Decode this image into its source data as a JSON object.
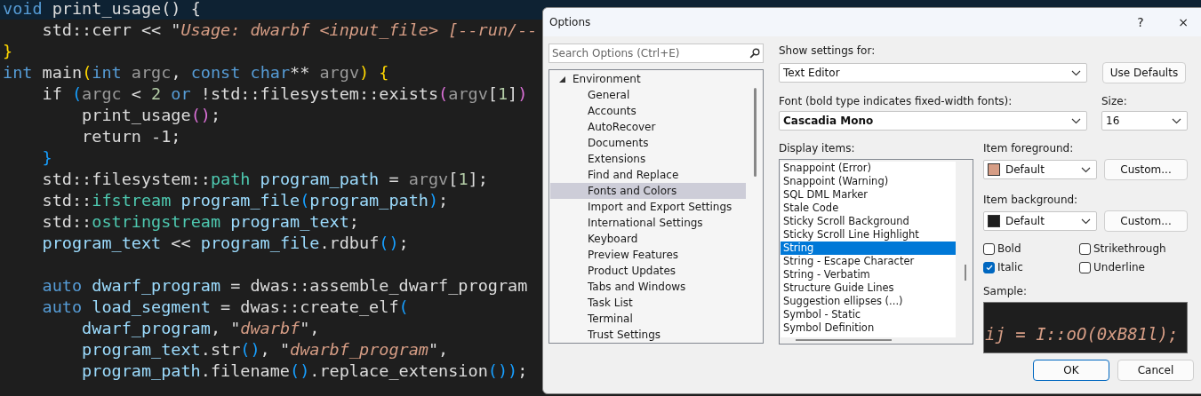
{
  "editor": {
    "lines": [
      {
        "current": true,
        "tokens": [
          {
            "kind": "kw",
            "text": "void"
          },
          {
            "kind": "plain",
            "text": " print_usage() {"
          }
        ]
      },
      {
        "current": false,
        "tokens": [
          {
            "kind": "plain",
            "text": "    std::cerr << \""
          },
          {
            "kind": "str",
            "text": "Usage: dwarbf <input_file> [--run/--"
          }
        ]
      },
      {
        "current": false,
        "tokens": [
          {
            "kind": "b1",
            "text": "}"
          }
        ]
      },
      {
        "current": false,
        "tokens": [
          {
            "kind": "kw",
            "text": "int"
          },
          {
            "kind": "plain",
            "text": " main"
          },
          {
            "kind": "b1",
            "text": "("
          },
          {
            "kind": "kw",
            "text": "int"
          },
          {
            "kind": "param",
            "text": " argc"
          },
          {
            "kind": "plain",
            "text": ", "
          },
          {
            "kind": "kw",
            "text": "const char"
          },
          {
            "kind": "plain",
            "text": "** "
          },
          {
            "kind": "param",
            "text": "argv"
          },
          {
            "kind": "b1",
            "text": ")"
          },
          {
            "kind": "b1",
            "text": " {"
          }
        ]
      },
      {
        "current": false,
        "tokens": [
          {
            "kind": "plain",
            "text": "    if "
          },
          {
            "kind": "b3",
            "text": "("
          },
          {
            "kind": "param",
            "text": "argc"
          },
          {
            "kind": "plain",
            "text": " < "
          },
          {
            "kind": "num",
            "text": "2"
          },
          {
            "kind": "kw",
            "text": " or"
          },
          {
            "kind": "plain",
            "text": " !std::filesystem::exists"
          },
          {
            "kind": "b2",
            "text": "("
          },
          {
            "kind": "param",
            "text": "argv"
          },
          {
            "kind": "plain",
            "text": "["
          },
          {
            "kind": "num",
            "text": "1"
          },
          {
            "kind": "plain",
            "text": "]"
          },
          {
            "kind": "b2",
            "text": ")"
          }
        ]
      },
      {
        "current": false,
        "tokens": [
          {
            "kind": "plain",
            "text": "        print_usage"
          },
          {
            "kind": "b2",
            "text": "()"
          },
          {
            "kind": "plain",
            "text": ";"
          }
        ]
      },
      {
        "current": false,
        "tokens": [
          {
            "kind": "plain",
            "text": "        return -1;"
          }
        ]
      },
      {
        "current": false,
        "tokens": [
          {
            "kind": "b3",
            "text": "    }"
          }
        ]
      },
      {
        "current": false,
        "tokens": [
          {
            "kind": "plain",
            "text": "    std::filesystem::"
          },
          {
            "kind": "type",
            "text": "path"
          },
          {
            "kind": "local",
            "text": " program_path"
          },
          {
            "kind": "plain",
            "text": " = "
          },
          {
            "kind": "param",
            "text": "argv"
          },
          {
            "kind": "plain",
            "text": "["
          },
          {
            "kind": "num",
            "text": "1"
          },
          {
            "kind": "plain",
            "text": "];"
          }
        ]
      },
      {
        "current": false,
        "tokens": [
          {
            "kind": "plain",
            "text": "    std::"
          },
          {
            "kind": "type",
            "text": "ifstream"
          },
          {
            "kind": "local",
            "text": " program_file"
          },
          {
            "kind": "b3",
            "text": "("
          },
          {
            "kind": "local",
            "text": "program_path"
          },
          {
            "kind": "b3",
            "text": ")"
          },
          {
            "kind": "plain",
            "text": ";"
          }
        ]
      },
      {
        "current": false,
        "tokens": [
          {
            "kind": "plain",
            "text": "    std::"
          },
          {
            "kind": "type",
            "text": "ostringstream"
          },
          {
            "kind": "local",
            "text": " program_text"
          },
          {
            "kind": "plain",
            "text": ";"
          }
        ]
      },
      {
        "current": false,
        "tokens": [
          {
            "kind": "local",
            "text": "    program_text"
          },
          {
            "kind": "plain",
            "text": " << "
          },
          {
            "kind": "local",
            "text": "program_file"
          },
          {
            "kind": "plain",
            "text": ".rdbuf"
          },
          {
            "kind": "b3",
            "text": "()"
          },
          {
            "kind": "plain",
            "text": ";"
          }
        ]
      },
      {
        "current": false,
        "blank": true
      },
      {
        "current": false,
        "tokens": [
          {
            "kind": "kw",
            "text": "    auto"
          },
          {
            "kind": "local",
            "text": " dwarf_program"
          },
          {
            "kind": "plain",
            "text": " = dwas::assemble_dwarf_program"
          }
        ]
      },
      {
        "current": false,
        "tokens": [
          {
            "kind": "kw",
            "text": "    auto"
          },
          {
            "kind": "local",
            "text": " load_segment"
          },
          {
            "kind": "plain",
            "text": " = dwas::create_elf"
          },
          {
            "kind": "b3",
            "text": "("
          }
        ]
      },
      {
        "current": false,
        "tokens": [
          {
            "kind": "local",
            "text": "        dwarf_program"
          },
          {
            "kind": "plain",
            "text": ", \""
          },
          {
            "kind": "str",
            "text": "dwarbf"
          },
          {
            "kind": "plain",
            "text": "\","
          }
        ]
      },
      {
        "current": false,
        "tokens": [
          {
            "kind": "local",
            "text": "        program_text"
          },
          {
            "kind": "plain",
            "text": ".str"
          },
          {
            "kind": "b3",
            "text": "()"
          },
          {
            "kind": "plain",
            "text": ", \""
          },
          {
            "kind": "str",
            "text": "dwarbf_program"
          },
          {
            "kind": "plain",
            "text": "\","
          }
        ]
      },
      {
        "current": false,
        "tokens": [
          {
            "kind": "local",
            "text": "        program_path"
          },
          {
            "kind": "plain",
            "text": ".filename"
          },
          {
            "kind": "b3",
            "text": "()"
          },
          {
            "kind": "plain",
            "text": ".replace_extension"
          },
          {
            "kind": "b3",
            "text": "())"
          },
          {
            "kind": "plain",
            "text": ";"
          }
        ]
      }
    ]
  },
  "dialog": {
    "title": "Options",
    "help": "?",
    "close": "×",
    "search": {
      "placeholder": "Search Options (Ctrl+E)"
    },
    "tree": [
      {
        "label": "Environment",
        "expanded": true,
        "selected": false,
        "children": [
          {
            "label": "General",
            "selected": false
          },
          {
            "label": "Accounts",
            "selected": false
          },
          {
            "label": "AutoRecover",
            "selected": false
          },
          {
            "label": "Documents",
            "selected": false
          },
          {
            "label": "Extensions",
            "selected": false
          },
          {
            "label": "Find and Replace",
            "selected": false
          },
          {
            "label": "Fonts and Colors",
            "selected": true
          },
          {
            "label": "Import and Export Settings",
            "selected": false
          },
          {
            "label": "International Settings",
            "selected": false
          },
          {
            "label": "Keyboard",
            "selected": false
          },
          {
            "label": "Preview Features",
            "selected": false
          },
          {
            "label": "Product Updates",
            "selected": false
          },
          {
            "label": "Tabs and Windows",
            "selected": false
          },
          {
            "label": "Task List",
            "selected": false
          },
          {
            "label": "Terminal",
            "selected": false
          },
          {
            "label": "Trust Settings",
            "selected": false
          }
        ]
      }
    ],
    "show_settings_for": {
      "label": "Show settings for:",
      "value": "Text Editor"
    },
    "use_defaults": "Use Defaults",
    "font": {
      "label": "Font (bold type indicates fixed-width fonts):",
      "value": "Cascadia Mono"
    },
    "size": {
      "label": "Size:",
      "value": "16"
    },
    "display_items": {
      "label": "Display items:",
      "items": [
        {
          "label": "Snappoint (Error)",
          "selected": false
        },
        {
          "label": "Snappoint (Warning)",
          "selected": false
        },
        {
          "label": "SQL DML Marker",
          "selected": false
        },
        {
          "label": "Stale Code",
          "selected": false
        },
        {
          "label": "Sticky Scroll Background",
          "selected": false
        },
        {
          "label": "Sticky Scroll Line Highlight",
          "selected": false
        },
        {
          "label": "String",
          "selected": true
        },
        {
          "label": "String - Escape Character",
          "selected": false
        },
        {
          "label": "String - Verbatim",
          "selected": false
        },
        {
          "label": "Structure Guide Lines",
          "selected": false
        },
        {
          "label": "Suggestion ellipses (...)",
          "selected": false
        },
        {
          "label": "Symbol - Static",
          "selected": false
        },
        {
          "label": "Symbol Definition",
          "selected": false
        }
      ]
    },
    "item_foreground": {
      "label": "Item foreground:",
      "value": "Default",
      "color": "#d69d85",
      "button": "Custom..."
    },
    "item_background": {
      "label": "Item background:",
      "value": "Default",
      "color": "#1e1e1e",
      "button": "Custom..."
    },
    "styles": [
      {
        "label": "Bold",
        "checked": false
      },
      {
        "label": "Strikethrough",
        "checked": false
      },
      {
        "label": "Italic",
        "checked": true
      },
      {
        "label": "Underline",
        "checked": false
      }
    ],
    "sample": {
      "label": "Sample:",
      "text": "ij = I::oO(0xB81l);"
    },
    "buttons": [
      {
        "label": "OK",
        "kind": "default"
      },
      {
        "label": "Cancel",
        "kind": "normal"
      }
    ]
  }
}
